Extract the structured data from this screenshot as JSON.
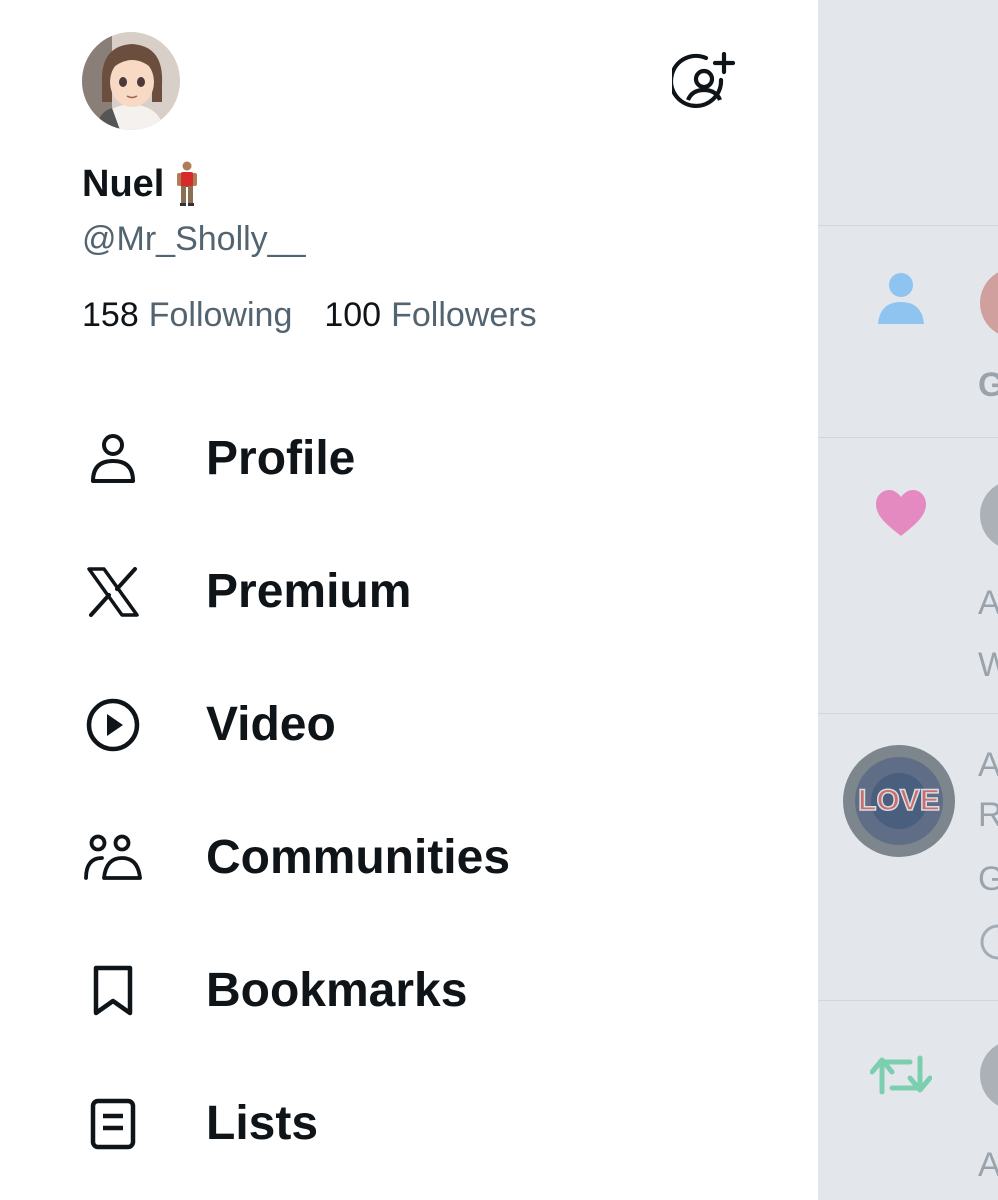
{
  "profile": {
    "display_name": "Nuel",
    "name_emoji": "🧍🏽‍♂️",
    "handle": "@Mr_Sholly__",
    "following_count": "158",
    "following_label": "Following",
    "followers_count": "100",
    "followers_label": "Followers"
  },
  "menu": {
    "items": [
      {
        "label": "Profile",
        "icon": "person-icon"
      },
      {
        "label": "Premium",
        "icon": "x-logo-icon"
      },
      {
        "label": "Video",
        "icon": "play-circle-icon"
      },
      {
        "label": "Communities",
        "icon": "communities-icon"
      },
      {
        "label": "Bookmarks",
        "icon": "bookmark-icon"
      },
      {
        "label": "Lists",
        "icon": "list-icon"
      }
    ]
  },
  "background": {
    "notifications": [
      {
        "icon": "follow-person-icon",
        "snippet": "G"
      },
      {
        "icon": "like-heart-icon",
        "snippet_1": "A",
        "snippet_2": "W"
      },
      {
        "icon": "chelsea-avatar",
        "avatar_text": "LOVE",
        "snippet_1": "A",
        "snippet_2": "R",
        "snippet_3": "G"
      },
      {
        "icon": "retweet-icon",
        "snippet": "A"
      }
    ]
  },
  "colors": {
    "text_primary": "#0f1419",
    "text_secondary": "#536471",
    "follow_icon": "#8ec4ef",
    "heart": "#e58ac1",
    "retweet": "#7ccfae"
  }
}
